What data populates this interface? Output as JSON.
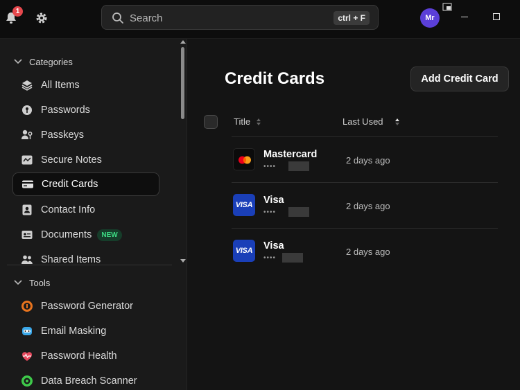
{
  "topbar": {
    "notification_count": "1",
    "search_placeholder": "Search",
    "search_shortcut": "ctrl + F",
    "avatar_initials": "Mr"
  },
  "sidebar": {
    "categories_label": "Categories",
    "categories": [
      {
        "label": "All Items",
        "icon": "layers-icon"
      },
      {
        "label": "Passwords",
        "icon": "key-icon"
      },
      {
        "label": "Passkeys",
        "icon": "passkey-icon"
      },
      {
        "label": "Secure Notes",
        "icon": "note-icon"
      },
      {
        "label": "Credit Cards",
        "icon": "credit-card-icon",
        "active": true
      },
      {
        "label": "Contact Info",
        "icon": "contact-icon"
      },
      {
        "label": "Documents",
        "icon": "document-icon",
        "badge": "NEW"
      },
      {
        "label": "Shared Items",
        "icon": "people-icon"
      }
    ],
    "tools_label": "Tools",
    "tools": [
      {
        "label": "Password Generator",
        "icon": "password-generator-icon"
      },
      {
        "label": "Email Masking",
        "icon": "email-mask-icon"
      },
      {
        "label": "Password Health",
        "icon": "heart-pulse-icon"
      },
      {
        "label": "Data Breach Scanner",
        "icon": "breach-scanner-icon"
      }
    ]
  },
  "main": {
    "title": "Credit Cards",
    "add_button": "Add Credit Card",
    "columns": {
      "title": "Title",
      "last_used": "Last Used"
    },
    "rows": [
      {
        "name": "Mastercard",
        "number": "••••",
        "last_used": "2 days ago",
        "brand": "mastercard"
      },
      {
        "name": "Visa",
        "number": "••••",
        "last_used": "2 days ago",
        "brand": "visa",
        "logo_text": "VISA"
      },
      {
        "name": "Visa",
        "number": "••••",
        "last_used": "2 days ago",
        "brand": "visa",
        "logo_text": "VISA"
      }
    ]
  },
  "colors": {
    "accent_avatar": "#5b3fd8",
    "badge_red": "#e5484d",
    "new_badge_green": "#3ddc84",
    "visa_blue": "#1a3fb8"
  }
}
